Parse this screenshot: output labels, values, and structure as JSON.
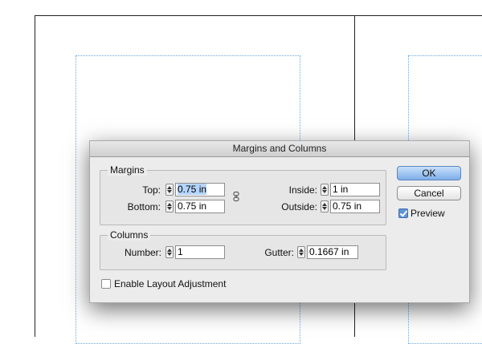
{
  "dialog": {
    "title": "Margins and Columns",
    "ok_label": "OK",
    "cancel_label": "Cancel",
    "preview": {
      "label": "Preview",
      "checked": true
    },
    "enable_layout": {
      "label": "Enable Layout Adjustment",
      "checked": false
    }
  },
  "margins": {
    "title": "Margins",
    "top": {
      "label": "Top:",
      "value": "0.75 in"
    },
    "bottom": {
      "label": "Bottom:",
      "value": "0.75 in"
    },
    "inside": {
      "label": "Inside:",
      "value": "1 in"
    },
    "outside": {
      "label": "Outside:",
      "value": "0.75 in"
    }
  },
  "columns": {
    "title": "Columns",
    "number": {
      "label": "Number:",
      "value": "1"
    },
    "gutter": {
      "label": "Gutter:",
      "value": "0.1667 in"
    }
  },
  "colors": {
    "guide": "#6fa8dc",
    "selection": "#b5d5ff",
    "ok_button": "#7eaeea"
  }
}
